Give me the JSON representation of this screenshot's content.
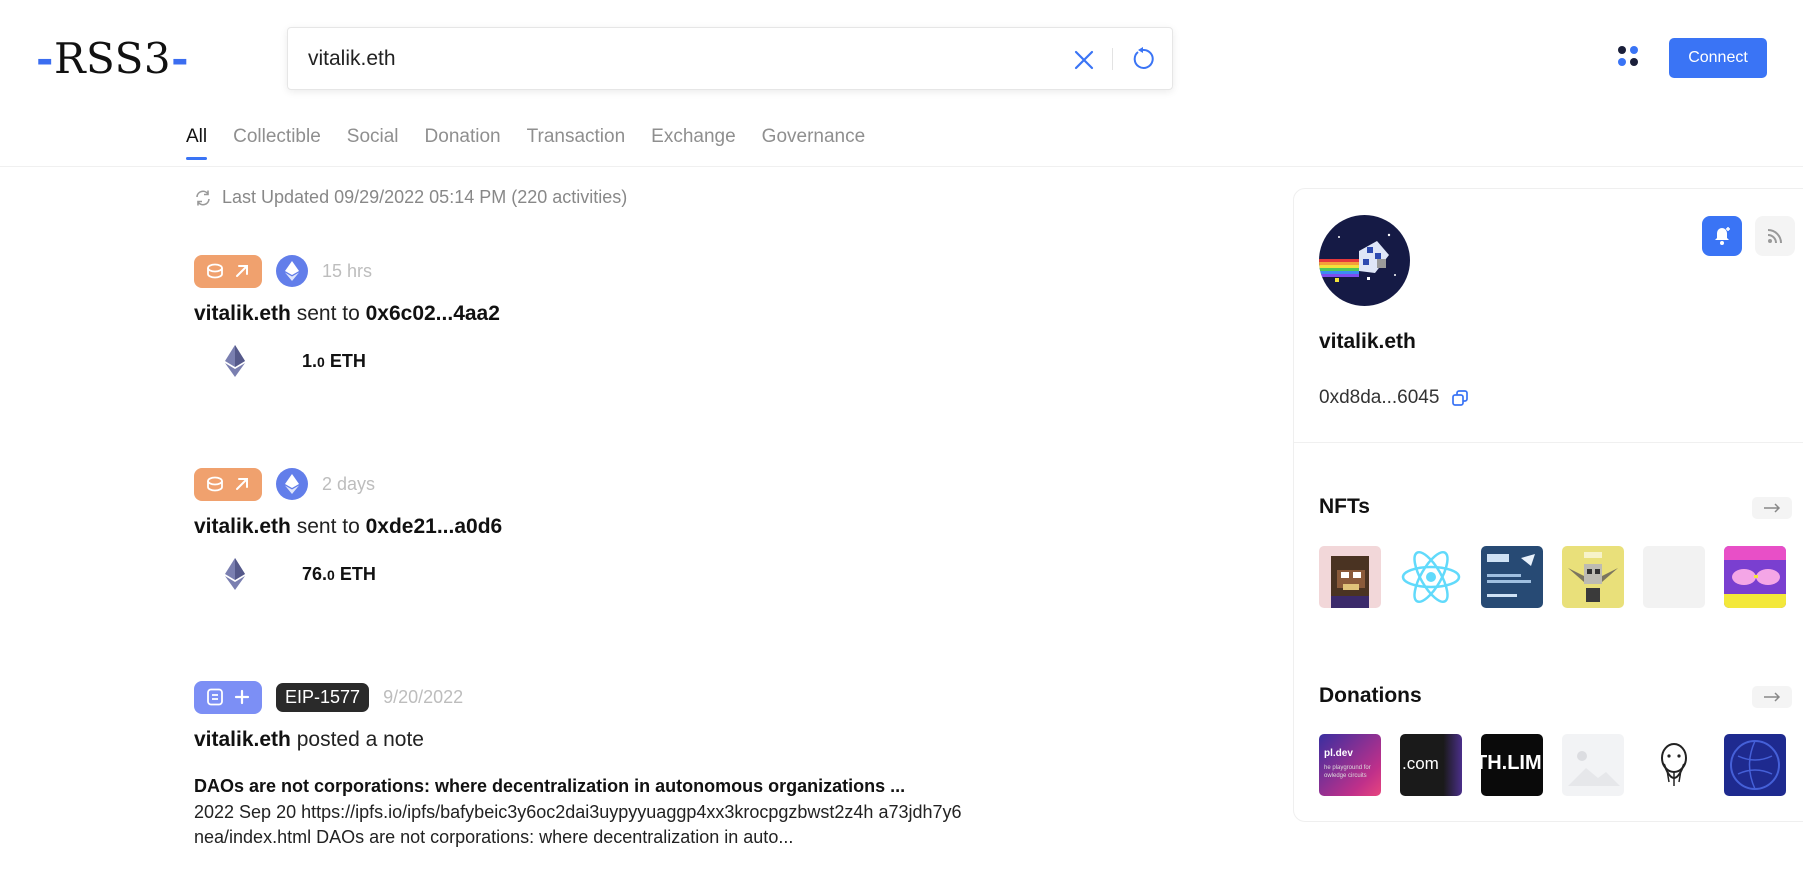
{
  "logo": {
    "dash_left": "-",
    "text": "RSS3",
    "dash_right": "-"
  },
  "search": {
    "value": "vitalik.eth"
  },
  "header": {
    "connect_label": "Connect"
  },
  "tabs": [
    {
      "label": "All",
      "active": true
    },
    {
      "label": "Collectible"
    },
    {
      "label": "Social"
    },
    {
      "label": "Donation"
    },
    {
      "label": "Transaction"
    },
    {
      "label": "Exchange"
    },
    {
      "label": "Governance"
    }
  ],
  "status": {
    "last_updated": "Last Updated 09/29/2022 05:14 PM (220 activities)"
  },
  "feed": [
    {
      "time": "15 hrs",
      "actor": "vitalik.eth",
      "action": "sent to",
      "target": "0x6c02...4aa2",
      "amount_int": "1.",
      "amount_dec": "0",
      "amount_unit": " ETH"
    },
    {
      "time": "2 days",
      "actor": "vitalik.eth",
      "action": "sent to",
      "target": "0xde21...a0d6",
      "amount_int": "76.",
      "amount_dec": "0",
      "amount_unit": " ETH"
    },
    {
      "tag": "EIP-1577",
      "time": "9/20/2022",
      "actor": "vitalik.eth",
      "action": "posted a note",
      "note_title": "DAOs are not corporations: where decentralization in autonomous organizations ...",
      "note_body": "2022 Sep 20 https://ipfs.io/ipfs/bafybeic3y6oc2dai3uypyyuaggp4xx3krocpgzbwst2z4h a73jdh7y6nea/index.html DAOs are not corporations: where decentralization in auto..."
    }
  ],
  "profile": {
    "name": "vitalik.eth",
    "address": "0xd8da...6045",
    "nfts_title": "NFTs",
    "donations_title": "Donations",
    "donation_thumb_texts": [
      "pl.dev",
      "he playground for\nowledge circuits",
      ".com",
      "TH.LIM"
    ]
  },
  "colors": {
    "accent": "#3a74f5",
    "transfer_badge": "#f0a16e",
    "post_badge": "#7c8ff5",
    "eth_chain": "#627eea"
  }
}
